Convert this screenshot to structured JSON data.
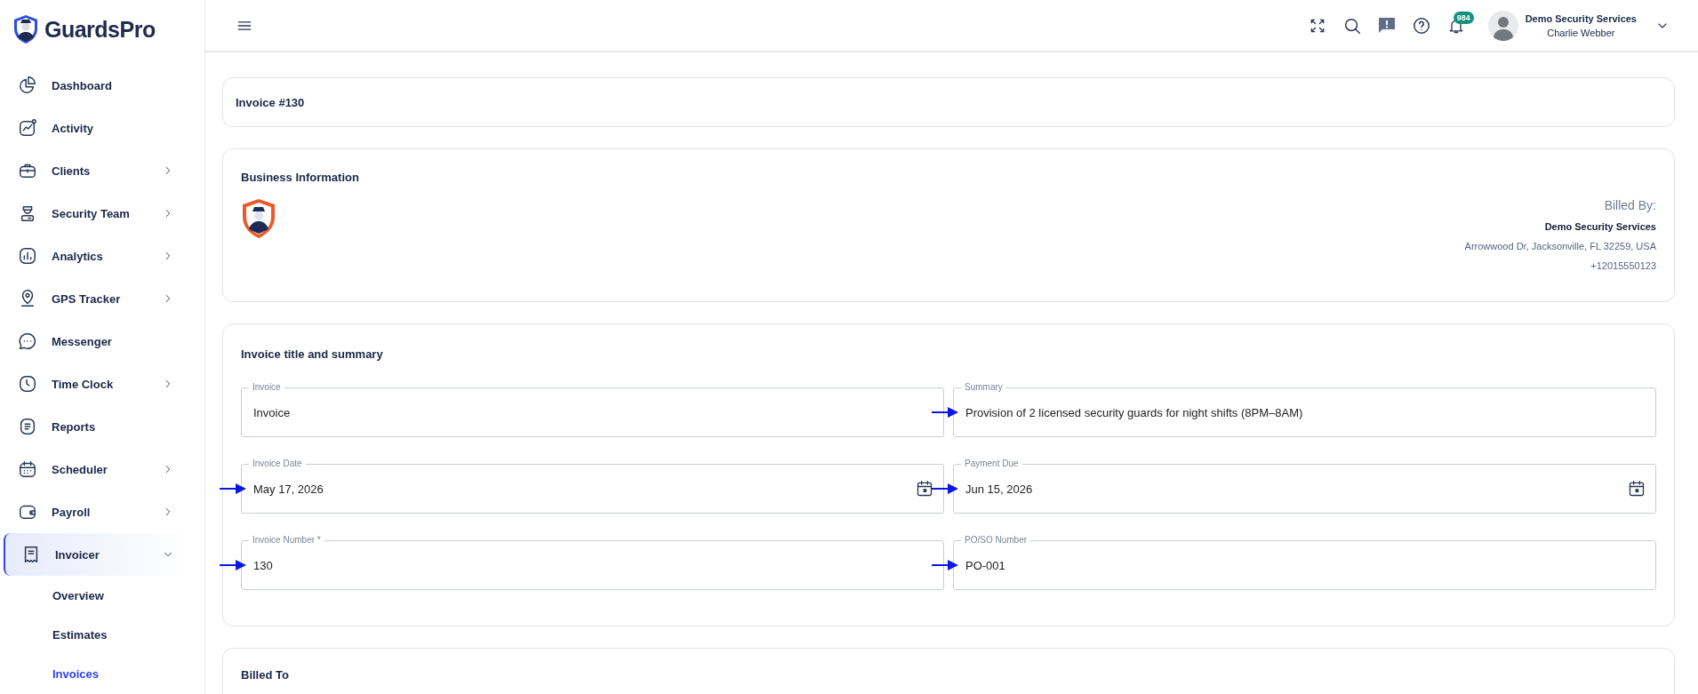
{
  "brand": {
    "name": "GuardsPro"
  },
  "sidebar": {
    "items": [
      {
        "label": "Dashboard",
        "kind": "link",
        "selected": false
      },
      {
        "label": "Activity",
        "kind": "link",
        "selected": false
      },
      {
        "label": "Clients",
        "kind": "group",
        "selected": false,
        "expanded": false
      },
      {
        "label": "Security Team",
        "kind": "group",
        "selected": false,
        "expanded": false
      },
      {
        "label": "Analytics",
        "kind": "group",
        "selected": false,
        "expanded": false
      },
      {
        "label": "GPS Tracker",
        "kind": "group",
        "selected": false,
        "expanded": false
      },
      {
        "label": "Messenger",
        "kind": "link",
        "selected": false
      },
      {
        "label": "Time Clock",
        "kind": "group",
        "selected": false,
        "expanded": false
      },
      {
        "label": "Reports",
        "kind": "link",
        "selected": false
      },
      {
        "label": "Scheduler",
        "kind": "group",
        "selected": false,
        "expanded": false
      },
      {
        "label": "Payroll",
        "kind": "group",
        "selected": false,
        "expanded": false
      },
      {
        "label": "Invoicer",
        "kind": "group",
        "selected": true,
        "expanded": true,
        "children": [
          {
            "label": "Overview",
            "selected": false
          },
          {
            "label": "Estimates",
            "selected": false
          },
          {
            "label": "Invoices",
            "selected": true
          }
        ]
      }
    ]
  },
  "topbar": {
    "notification_count": "984",
    "account": {
      "company": "Demo Security Services",
      "user": "Charlie Webber"
    }
  },
  "invoice_header": {
    "title": "Invoice #130"
  },
  "business_information": {
    "heading": "Business Information",
    "billed_by_label": "Billed By:",
    "company": "Demo Security Services",
    "address": "Arrowwood Dr, Jacksonville, FL 32259, USA",
    "phone": "+12015550123"
  },
  "invoice_summary": {
    "heading": "Invoice title and summary",
    "fields": [
      {
        "label": "Invoice",
        "value": "Invoice",
        "kind": "text",
        "annotated": false
      },
      {
        "label": "Summary",
        "value": "Provision of 2 licensed security guards for night shifts (8PM–8AM)",
        "kind": "text",
        "annotated": true
      },
      {
        "label": "Invoice Date",
        "value": "May 17, 2026",
        "kind": "date",
        "annotated": true
      },
      {
        "label": "Payment Due",
        "value": "Jun 15, 2026",
        "kind": "date",
        "annotated": true
      },
      {
        "label": "Invoice Number *",
        "value": "130",
        "kind": "text",
        "annotated": true
      },
      {
        "label": "PO/SO Number",
        "value": "PO-001",
        "kind": "text",
        "annotated": true
      }
    ]
  },
  "billed_to": {
    "heading": "Billed To"
  }
}
